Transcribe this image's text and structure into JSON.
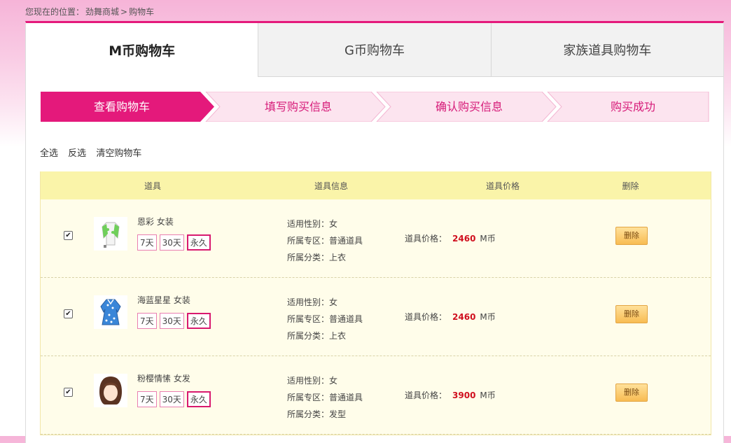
{
  "breadcrumb": {
    "label": "您现在的位置：",
    "home": "劲舞商城",
    "sep": ">",
    "current": "购物车"
  },
  "tabs": [
    {
      "label": "M币购物车",
      "active": true
    },
    {
      "label": "G币购物车",
      "active": false
    },
    {
      "label": "家族道具购物车",
      "active": false
    }
  ],
  "steps": [
    {
      "label": "查看购物车",
      "active": true
    },
    {
      "label": "填写购买信息",
      "active": false
    },
    {
      "label": "确认购买信息",
      "active": false
    },
    {
      "label": "购买成功",
      "active": false
    }
  ],
  "colors": {
    "accent": "#e4197b",
    "step_active": "#e4197b",
    "step_inactive": "#fce4ef",
    "price": "#d0101f",
    "header_bg": "#faf4a9",
    "row_bg": "#fffdea"
  },
  "actions": {
    "select_all": "全选",
    "invert": "反选",
    "clear": "清空购物车"
  },
  "table": {
    "headers": {
      "item": "道具",
      "info": "道具信息",
      "price": "道具价格",
      "delete": "删除"
    },
    "gender_label": "适用性别：",
    "zone_label": "所属专区：",
    "category_label": "所属分类：",
    "price_label": "道具价格：",
    "currency": "M币",
    "delete_label": "删除",
    "rows": [
      {
        "checked": true,
        "icon": "green-top-icon",
        "name": "恩彩 女装",
        "durations": [
          "7天",
          "30天",
          "永久"
        ],
        "selected_duration": "永久",
        "gender": "女",
        "zone": "普通道具",
        "category": "上衣",
        "price": "2460"
      },
      {
        "checked": true,
        "icon": "blue-dress-icon",
        "name": "海蓝星星 女装",
        "durations": [
          "7天",
          "30天",
          "永久"
        ],
        "selected_duration": "永久",
        "gender": "女",
        "zone": "普通道具",
        "category": "上衣",
        "price": "2460"
      },
      {
        "checked": true,
        "icon": "brown-hair-icon",
        "name": "粉樱情愫 女发",
        "durations": [
          "7天",
          "30天",
          "永久"
        ],
        "selected_duration": "永久",
        "gender": "女",
        "zone": "普通道具",
        "category": "发型",
        "price": "3900"
      }
    ]
  }
}
